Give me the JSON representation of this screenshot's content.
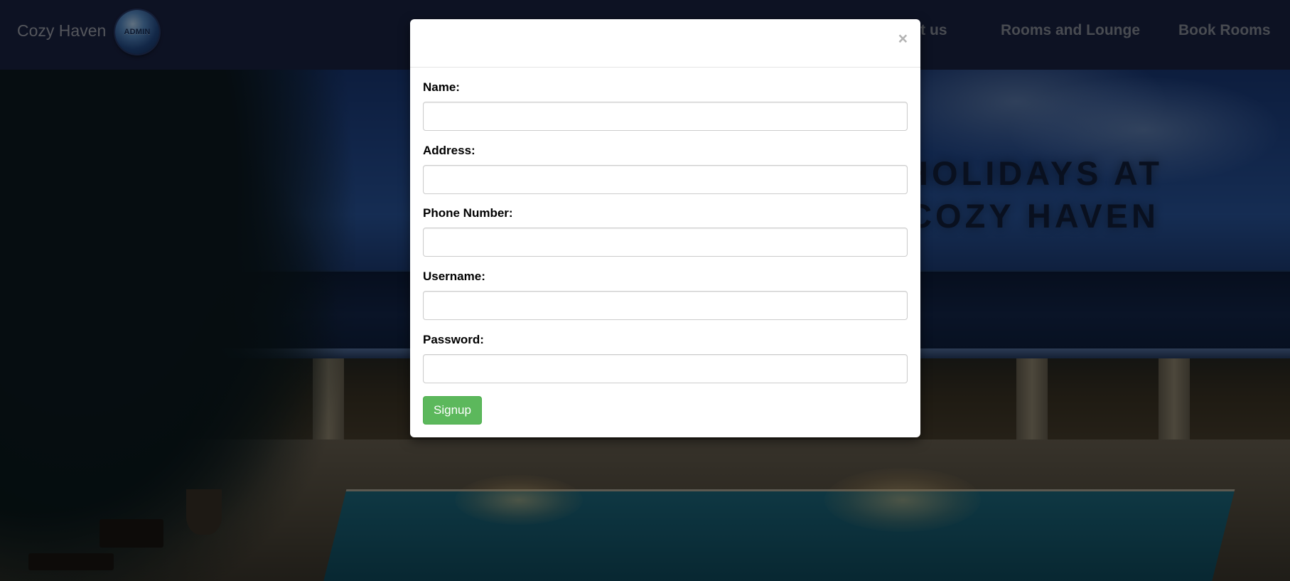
{
  "navbar": {
    "brand": "Cozy Haven",
    "admin_logo_text": "ADMIN",
    "links": [
      "Contact us",
      "Rooms and Lounge",
      "Book Rooms"
    ]
  },
  "hero": {
    "title_line1": "HOLIDAYS AT",
    "title_line2": "COZY HAVEN"
  },
  "modal": {
    "close_glyph": "×",
    "fields": [
      {
        "label": "Name:",
        "value": "",
        "placeholder": ""
      },
      {
        "label": "Address:",
        "value": "",
        "placeholder": ""
      },
      {
        "label": "Phone Number:",
        "value": "",
        "placeholder": ""
      },
      {
        "label": "Username:",
        "value": "",
        "placeholder": ""
      },
      {
        "label": "Password:",
        "value": "",
        "placeholder": ""
      }
    ],
    "submit_label": "Signup"
  },
  "colors": {
    "navbar_bg": "#1b2446",
    "signup_button": "#5cb85c",
    "modal_bg": "#ffffff",
    "overlay": "rgba(0,0,0,0.5)"
  }
}
